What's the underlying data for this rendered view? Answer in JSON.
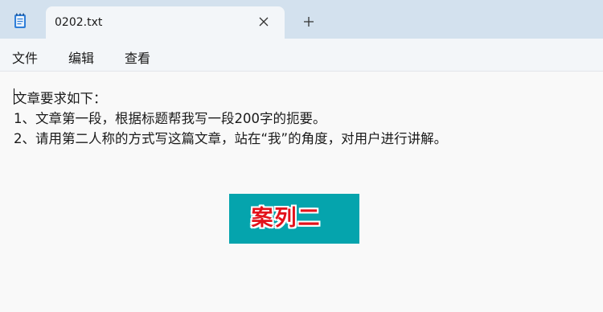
{
  "tab": {
    "title": "0202.txt"
  },
  "icons": {
    "app": "notepad-icon",
    "close": "close-icon",
    "new_tab": "plus-icon"
  },
  "menu": {
    "items": [
      "文件",
      "编辑",
      "查看"
    ]
  },
  "editor": {
    "lines": [
      "文章要求如下：",
      "1、文章第一段，根据标题帮我写一段200字的扼要。",
      "2、请用第二人称的方式写这篇文章，站在“我”的角度，对用户进行讲解。"
    ]
  },
  "banner": {
    "text": "案列二",
    "background": "#05a4ad",
    "text_color": "#e3121b"
  },
  "colors": {
    "titlebar": "#d3e1ee",
    "tab": "#f3f6f9",
    "editor_bg": "#f9f9f9"
  }
}
